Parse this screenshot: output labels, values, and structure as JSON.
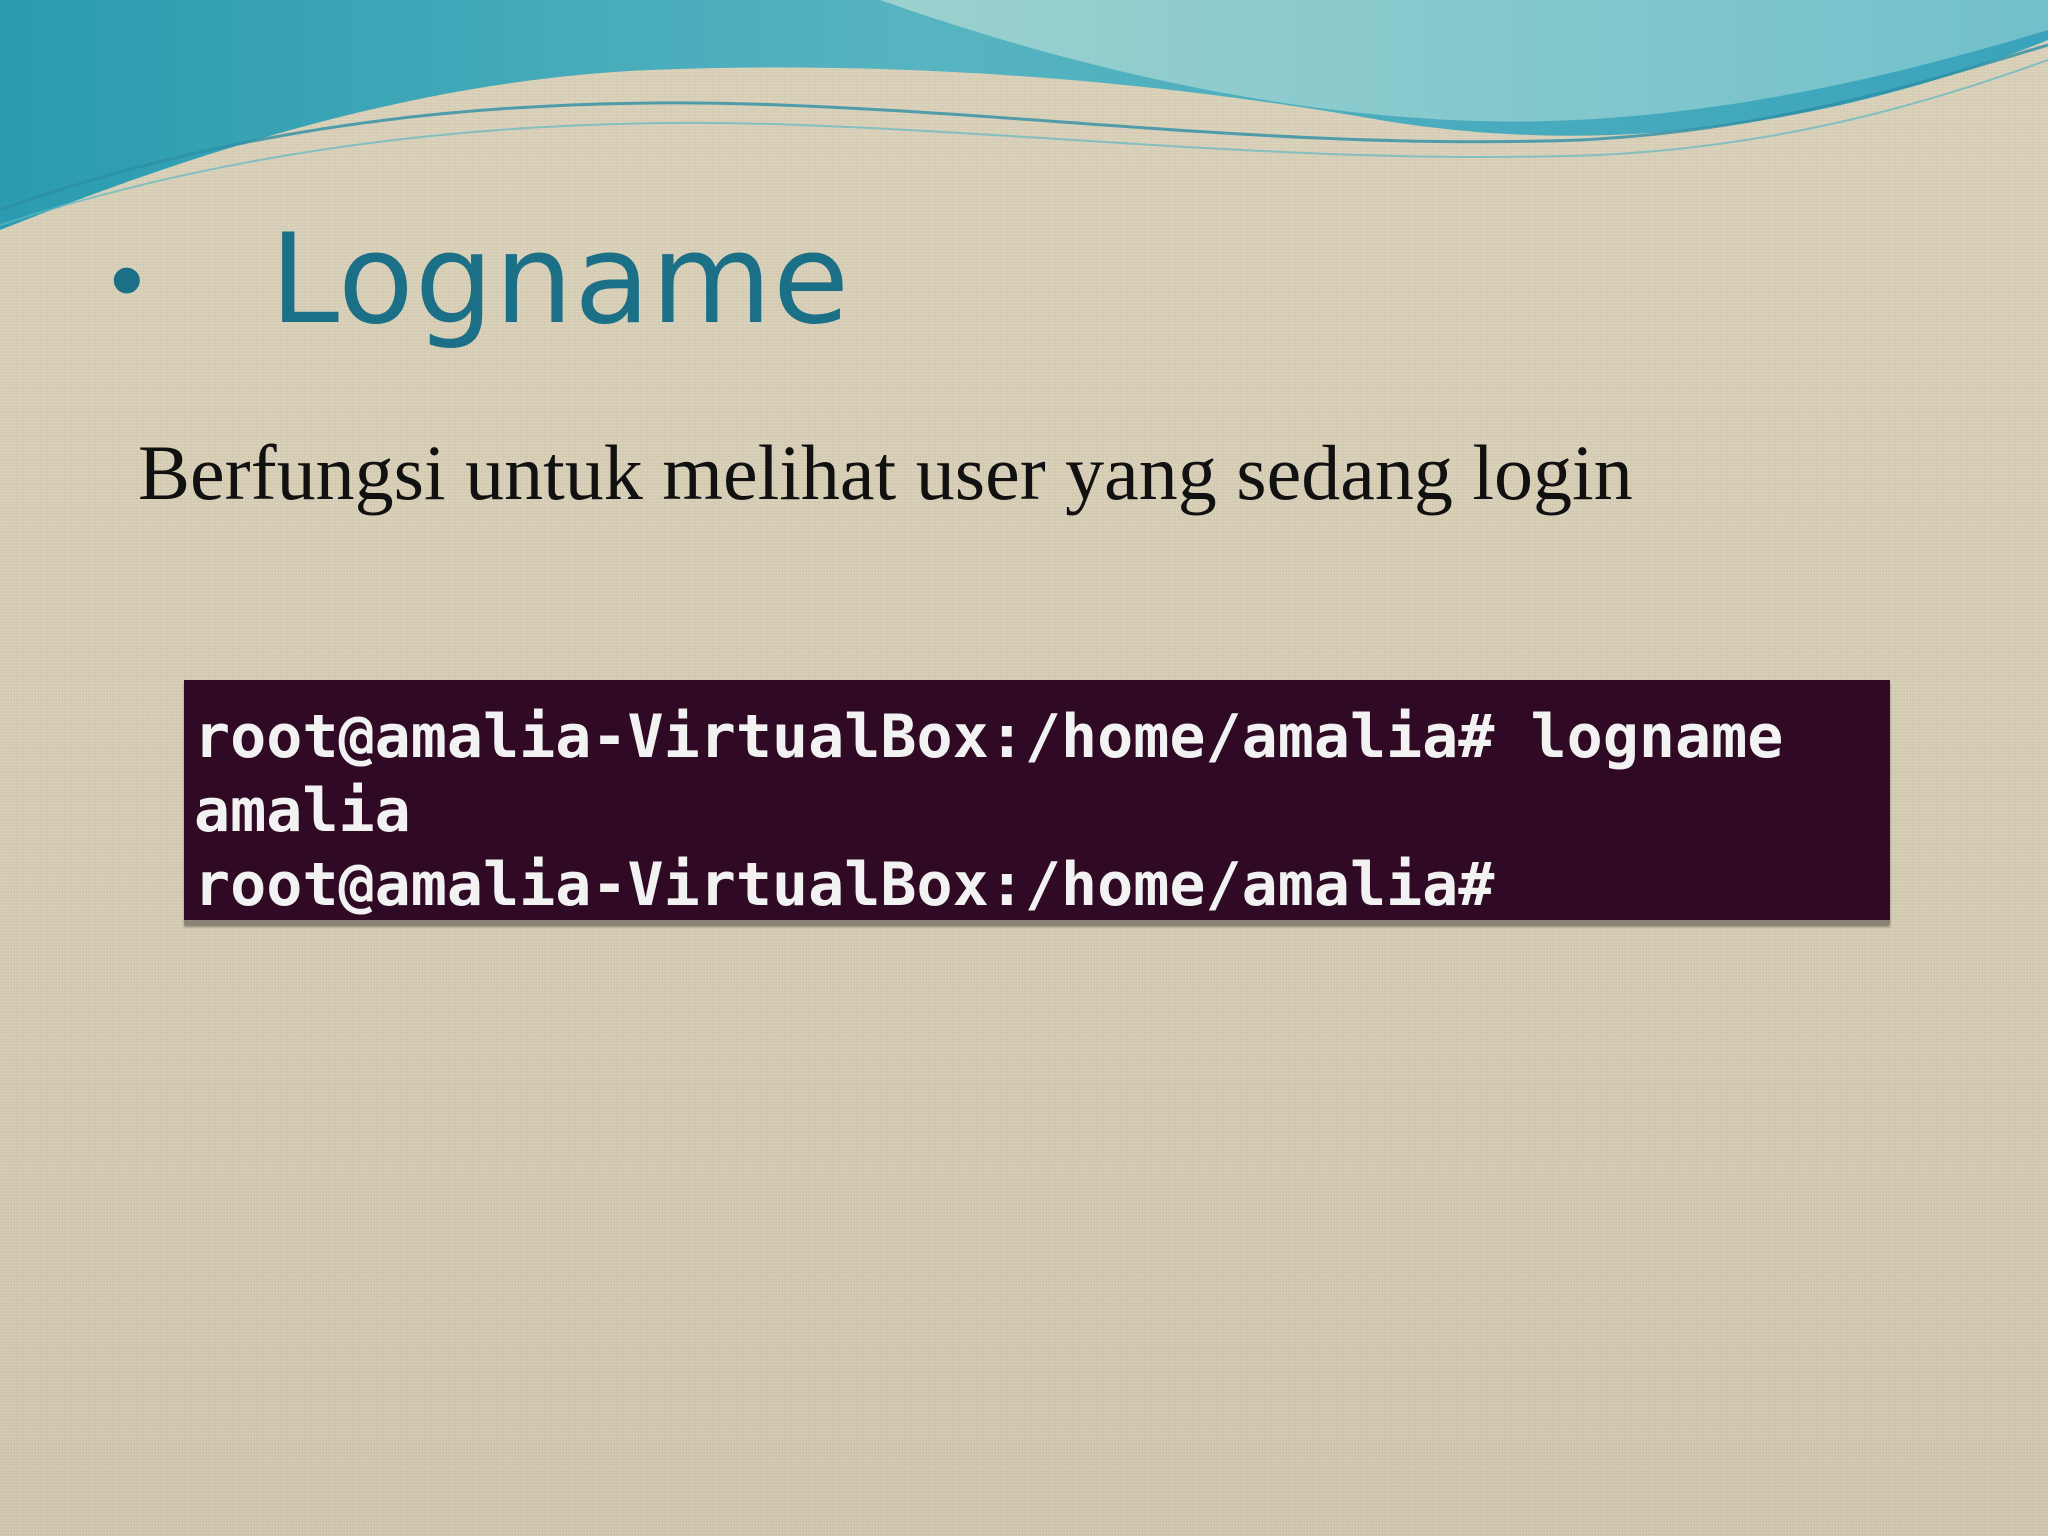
{
  "slide": {
    "bullet": "•",
    "title": "Logname",
    "subtitle": "Berfungsi untuk melihat user yang sedang login"
  },
  "terminal": {
    "lines": [
      "root@amalia-VirtualBox:/home/amalia# logname",
      "amalia",
      "root@amalia-VirtualBox:/home/amalia#"
    ],
    "background_color": "#300a24",
    "text_color": "#f2f2f2"
  },
  "colors": {
    "title": "#1b6f86",
    "background": "#d9ceb4",
    "wave_primary": "#2f9fb3"
  }
}
